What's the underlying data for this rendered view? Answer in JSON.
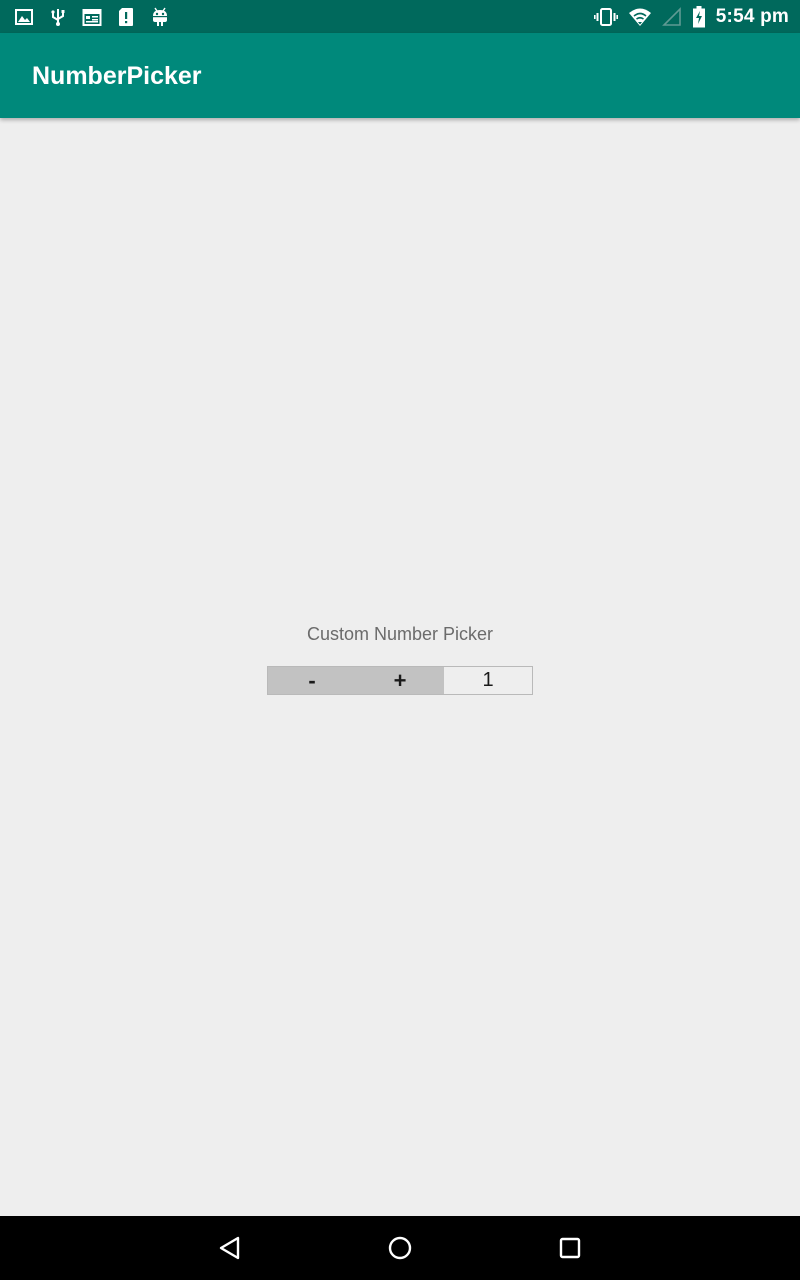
{
  "status_bar": {
    "time": "5:54 pm",
    "left_icons": [
      "image-icon",
      "usb-icon",
      "calendar-icon",
      "sd-card-alert-icon",
      "android-icon"
    ],
    "right_icons": [
      "vibrate-icon",
      "wifi-icon",
      "cellular-signal-icon",
      "battery-charging-icon"
    ],
    "background": "#00695c"
  },
  "app_bar": {
    "title": "NumberPicker",
    "background": "#00897b"
  },
  "main": {
    "label": "Custom Number Picker",
    "picker": {
      "decrement_label": "-",
      "increment_label": "+",
      "value": "1"
    }
  },
  "nav_bar": {
    "icons": [
      "back-icon",
      "home-icon",
      "recents-icon"
    ]
  }
}
